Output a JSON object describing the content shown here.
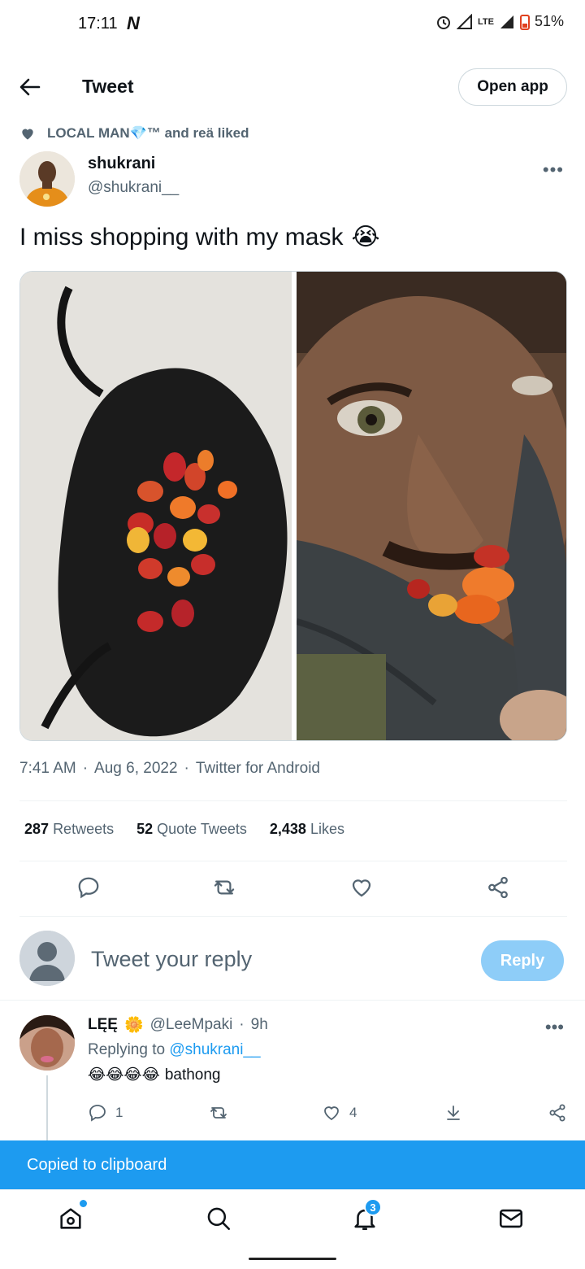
{
  "status_bar": {
    "time": "17:11",
    "app_indicator": "N",
    "network": "LTE",
    "battery": "51%"
  },
  "header": {
    "title": "Tweet",
    "open_app_label": "Open app"
  },
  "social_context": {
    "text": "LOCAL MAN💎™ and reä liked"
  },
  "author": {
    "name": "shukrani",
    "handle": "@shukrani__"
  },
  "tweet": {
    "text": "I miss shopping with my mask",
    "emoji": "😭",
    "time": "7:41 AM",
    "date": "Aug 6, 2022",
    "source": "Twitter for Android"
  },
  "stats": {
    "retweets_count": "287",
    "retweets_label": "Retweets",
    "quotes_count": "52",
    "quotes_label": "Quote Tweets",
    "likes_count": "2,438",
    "likes_label": "Likes"
  },
  "icons": {
    "actions": [
      "reply-icon",
      "retweet-icon",
      "like-icon",
      "share-icon"
    ],
    "nav": [
      "home-icon",
      "search-icon",
      "notifications-icon",
      "messages-icon"
    ]
  },
  "compose": {
    "placeholder": "Tweet your reply",
    "reply_button": "Reply"
  },
  "comment": {
    "name": "LĘĘ",
    "name_emoji": "🌼",
    "handle": "@LeeMpaki",
    "time": "9h",
    "replying_prefix": "Replying to",
    "replying_to": "@shukrani__",
    "emojis": "😂😂😂😂",
    "text": "bathong",
    "reply_count": "1",
    "like_count": "4"
  },
  "toast": {
    "text": "Copied to clipboard"
  },
  "bottom_nav": {
    "notification_count": "3"
  },
  "colors": {
    "accent": "#1d9bf0",
    "reply_button": "#8ecdf8",
    "secondary_text": "#536471"
  }
}
